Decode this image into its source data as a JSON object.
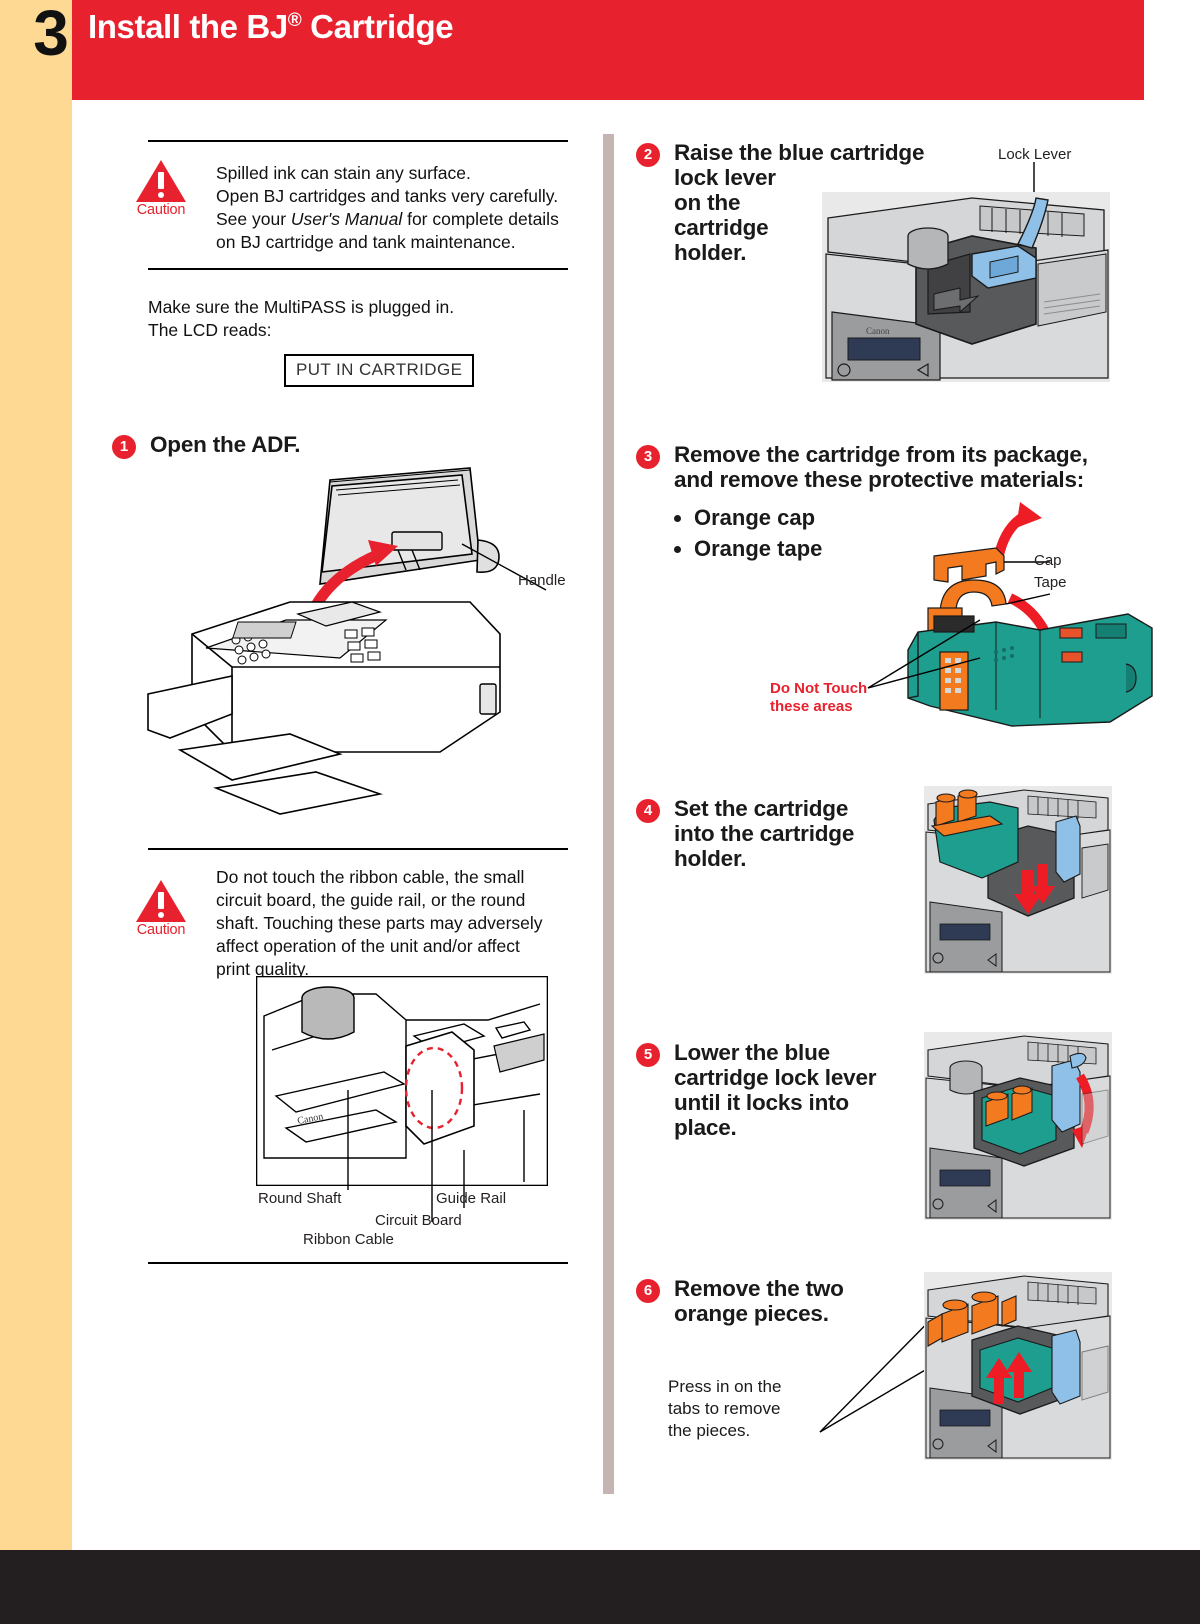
{
  "header": {
    "chapter_number": "3",
    "title_main": "Install the BJ",
    "title_sup": "®",
    "title_tail": " Cartridge",
    "band_color": "#e8212e",
    "rail_color": "#fdd994"
  },
  "left_column": {
    "caution_top": {
      "icon_label": "Caution",
      "lines": [
        "Spilled ink can stain any surface.",
        "Open BJ cartridges and tanks very carefully.",
        "See your User's Manual for complete details",
        "on BJ cartridge and tank maintenance."
      ],
      "italic_phrase": "User's Manual"
    },
    "plugged_note": {
      "line1": "Make sure the MultiPASS is plugged in.",
      "line2": "The LCD reads:"
    },
    "lcd_value": "PUT IN CARTRIDGE",
    "step1": {
      "number": "1",
      "text": "Open the ADF."
    },
    "figure1_labels": {
      "handle": "Handle"
    },
    "caution_bottom": {
      "icon_label": "Caution",
      "lines": [
        "Do not touch the ribbon cable, the small",
        "circuit board, the guide rail, or the round",
        "shaft. Touching these parts may adversely",
        "affect operation of the unit and/or affect",
        "print quality."
      ]
    },
    "figure2_labels": {
      "round_shaft": "Round Shaft",
      "ribbon_cable": "Ribbon Cable",
      "circuit_board": "Circuit Board",
      "guide_rail": "Guide Rail"
    }
  },
  "right_column": {
    "step2": {
      "number": "2",
      "lines": [
        "Raise the blue cartridge",
        "lock lever",
        "on the",
        "cartridge",
        "holder."
      ],
      "label_lock_lever": "Lock Lever"
    },
    "step3": {
      "number": "3",
      "lines": [
        "Remove the cartridge from its package,",
        "and remove these protective materials:"
      ],
      "bullets": [
        "Orange cap",
        "Orange tape"
      ],
      "label_cap": "Cap",
      "label_tape": "Tape",
      "warning_line1": "Do Not Touch",
      "warning_line2": "these areas"
    },
    "step4": {
      "number": "4",
      "lines": [
        "Set the cartridge",
        "into the cartridge",
        "holder."
      ]
    },
    "step5": {
      "number": "5",
      "lines": [
        "Lower the blue",
        "cartridge lock lever",
        "until it locks into",
        "place."
      ]
    },
    "step6": {
      "number": "6",
      "lines": [
        "Remove the two",
        "orange pieces."
      ],
      "note": [
        "Press in on the",
        "tabs to remove",
        "the pieces."
      ]
    }
  },
  "colors": {
    "accent_red": "#e8212e",
    "cream": "#fdd994",
    "divider": "#c4b5b2",
    "footer": "#231f20",
    "cartridge_green": "#1e9e8f",
    "orange": "#f47a20",
    "lever_blue": "#8fc0e8"
  }
}
